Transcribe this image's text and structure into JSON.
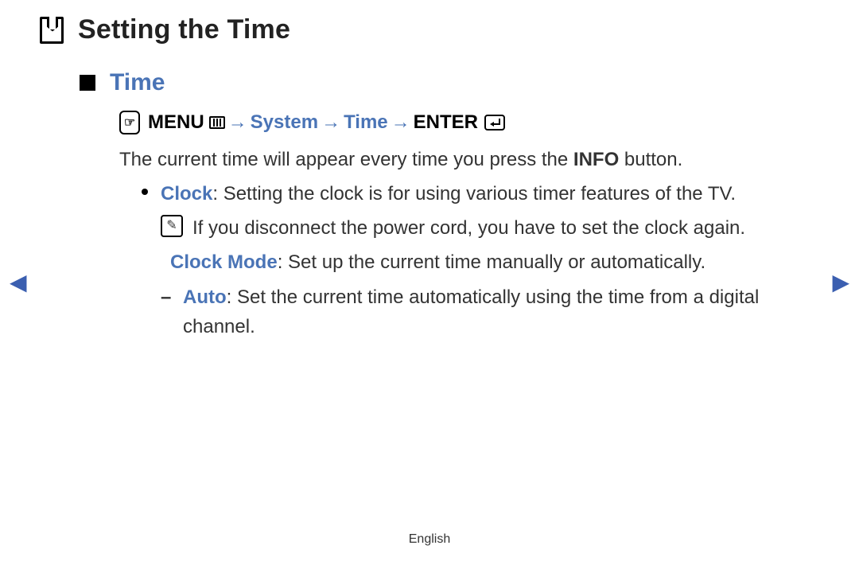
{
  "header": {
    "title": "Setting the Time"
  },
  "section": {
    "title": "Time"
  },
  "path": {
    "menu": "MENU",
    "arrow1": "→",
    "system": "System",
    "arrow2": "→",
    "time": "Time",
    "arrow3": "→",
    "enter": "ENTER"
  },
  "intro": {
    "pre": "The current time will appear every time you press the ",
    "bold": "INFO",
    "post": " button."
  },
  "clock_item": {
    "term": "Clock",
    "text": ": Setting the clock is for using various timer features of the TV."
  },
  "note": {
    "text": "If you disconnect the power cord, you have to set the clock again."
  },
  "clock_mode": {
    "term": "Clock Mode",
    "text": ": Set up the current time manually or automatically."
  },
  "auto_item": {
    "term": "Auto",
    "text": ": Set the current time automatically using the time from a digital channel."
  },
  "footer": {
    "language": "English"
  },
  "icons": {
    "hand": "☞",
    "note": "✎"
  }
}
